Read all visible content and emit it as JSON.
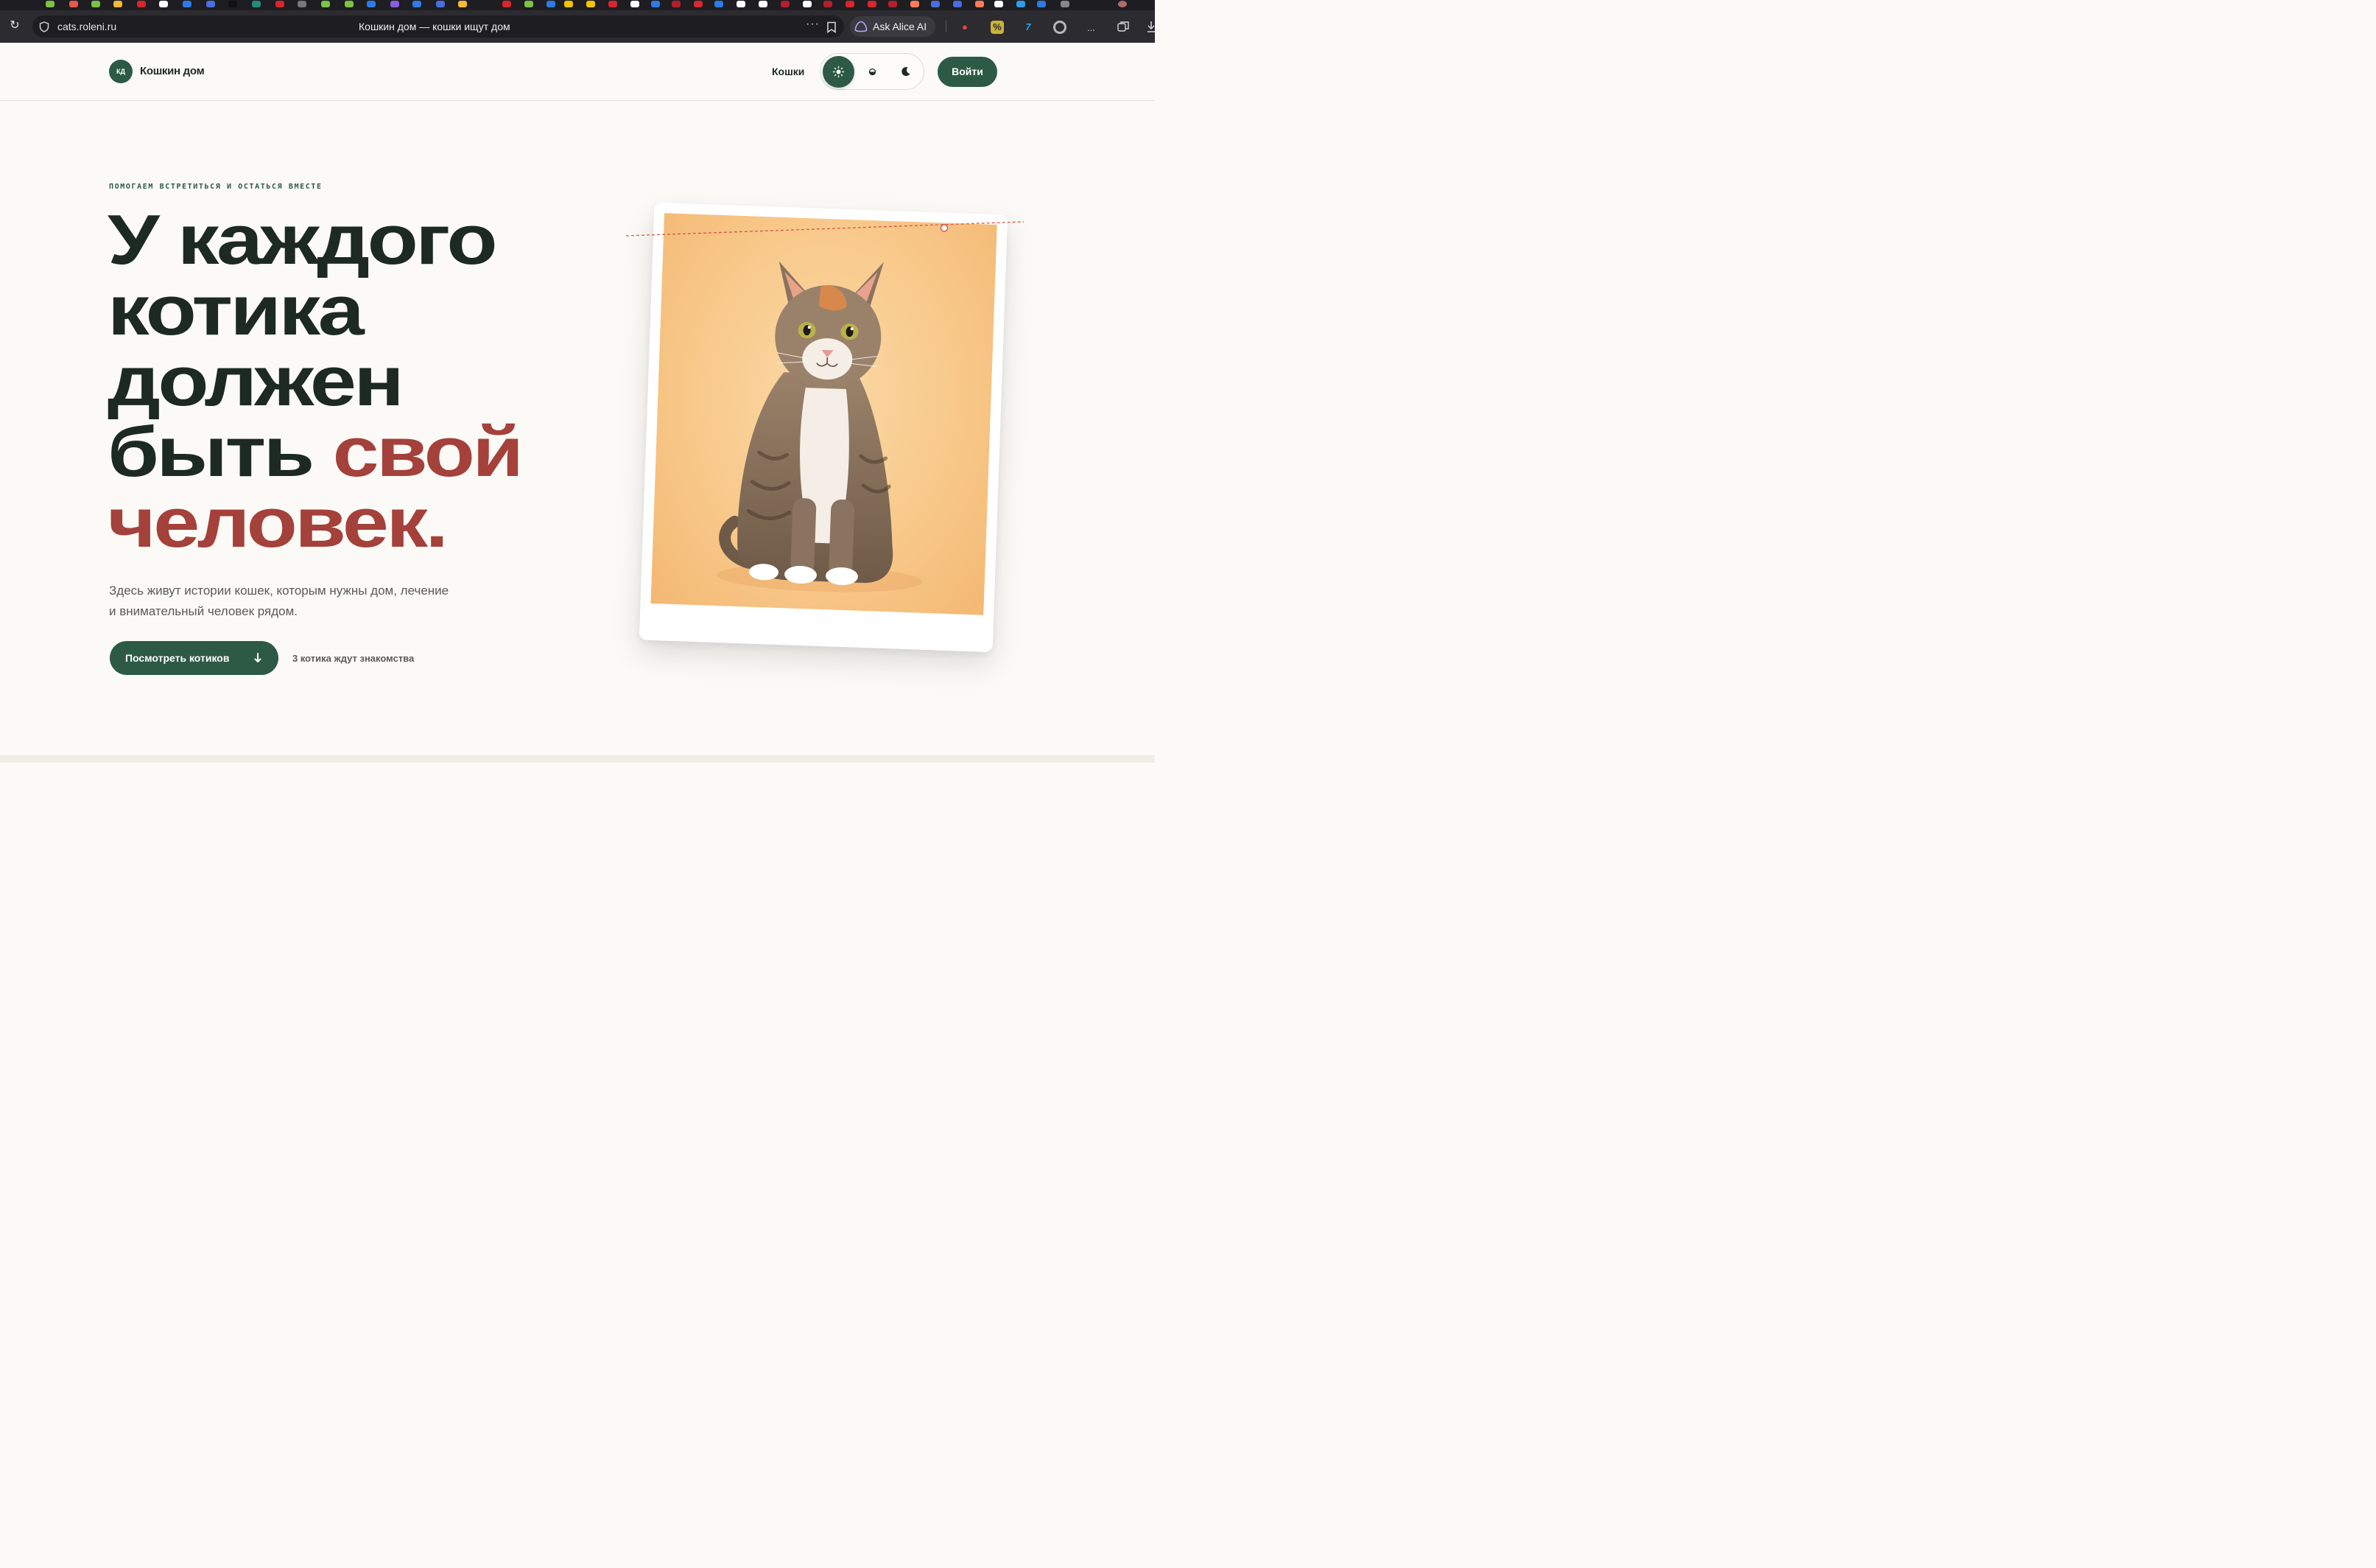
{
  "browser": {
    "url": "cats.roleni.ru",
    "tab_title": "Кошкин дом — кошки ищут дом",
    "more_label": "···",
    "assistant_label": "Ask Alice AI",
    "ext_overflow": "...",
    "extensions": [
      "ladybug-icon",
      "percent-icon",
      "seven-icon",
      "circle-icon"
    ]
  },
  "site": {
    "logo_badge": "КД",
    "logo_name": "Кошкин дом",
    "nav": {
      "cats": "Кошки"
    },
    "theme_options": [
      "light",
      "auto",
      "dark"
    ],
    "theme_selected": "light",
    "login": "Войти"
  },
  "hero": {
    "eyebrow": "ПОМОГАЕМ ВСТРЕТИТЬСЯ И ОСТАТЬСЯ ВМЕСТЕ",
    "headline": {
      "line1": "У каждого",
      "line2": "котика",
      "line3": "должен",
      "line4_dark": "быть ",
      "line4_accent": "свой",
      "line5_accent": "человек."
    },
    "lead_line1": "Здесь живут истории кошек, которым нужны дом, лечение",
    "lead_line2": "и внимательный человек рядом.",
    "cta": "Посмотреть котиков",
    "waiting": "3 котика ждут знакомства"
  },
  "colors": {
    "brand_green": "#2d5a45",
    "accent_red": "#a4413b",
    "ink": "#1c2a22",
    "background": "#fcfaf6"
  }
}
